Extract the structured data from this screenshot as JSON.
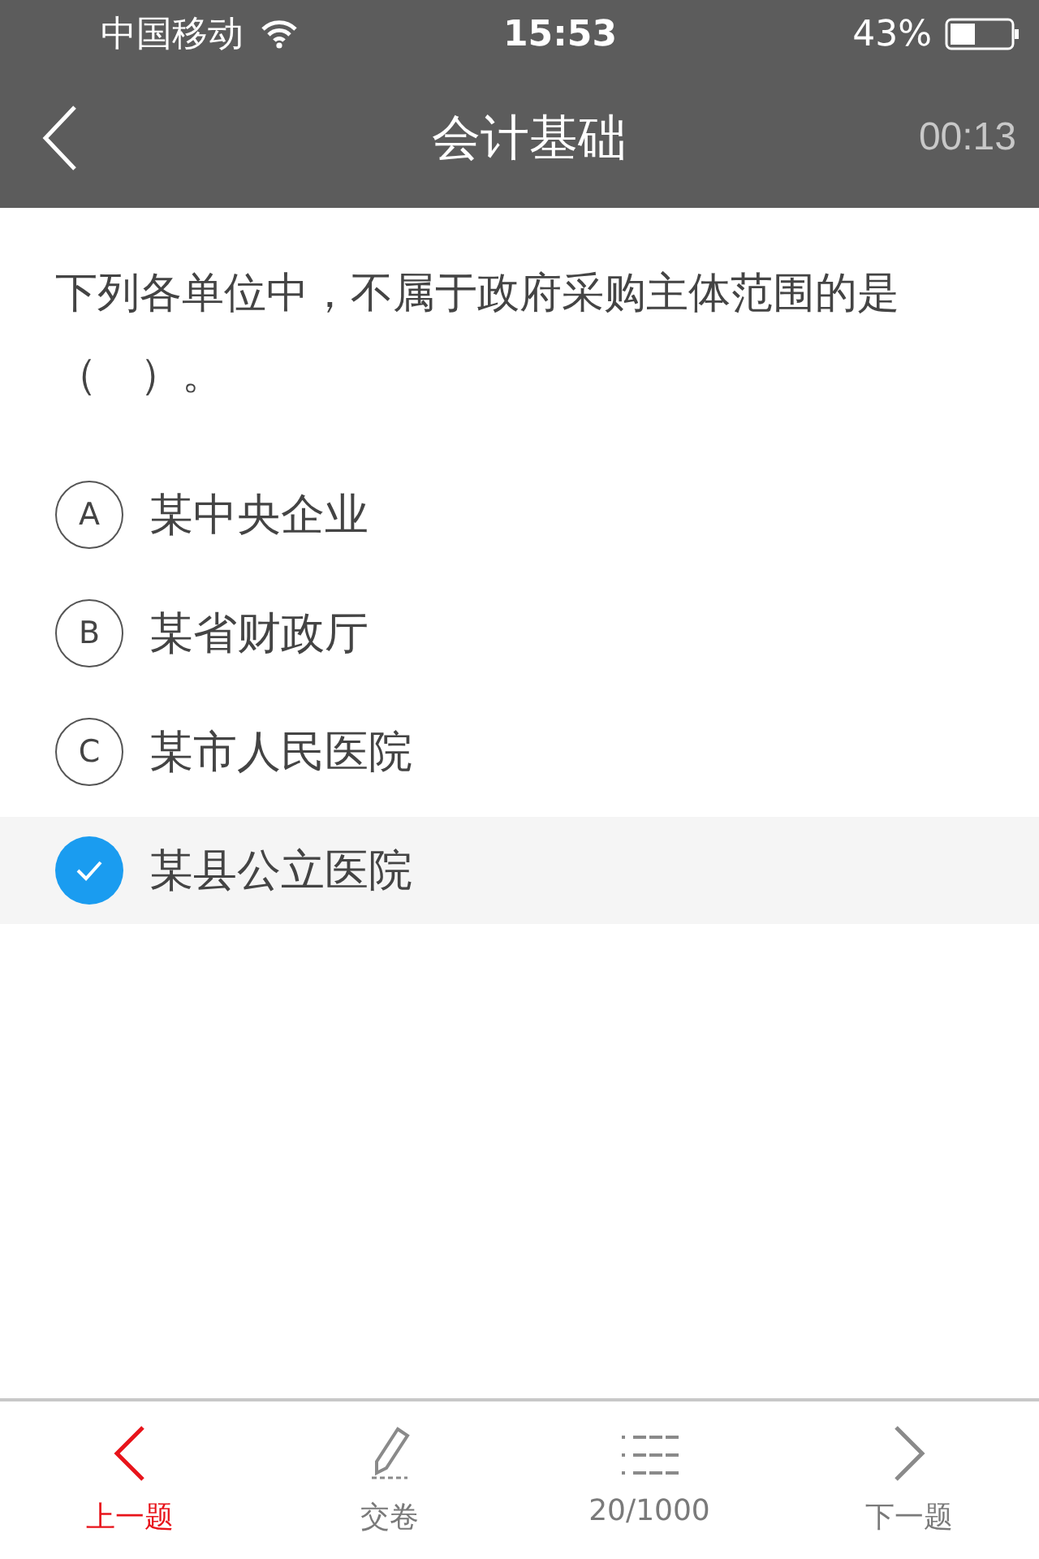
{
  "status_bar": {
    "carrier": "中国移动",
    "time": "15:53",
    "battery": "43%"
  },
  "nav": {
    "title": "会计基础",
    "timer": "00:13"
  },
  "question": "下列各单位中，不属于政府采购主体范围的是（　）。",
  "options": [
    {
      "letter": "A",
      "text": "某中央企业",
      "selected": false
    },
    {
      "letter": "B",
      "text": "某省财政厅",
      "selected": false
    },
    {
      "letter": "C",
      "text": "某市人民医院",
      "selected": false
    },
    {
      "text": "某县公立医院",
      "selected": true
    }
  ],
  "toolbar": [
    {
      "kind": "prev",
      "label": "上一题",
      "highlighted": true
    },
    {
      "kind": "submit",
      "label": "交卷",
      "highlighted": false
    },
    {
      "kind": "list",
      "label": "20/1000",
      "highlighted": false
    },
    {
      "kind": "next",
      "label": "下一题",
      "highlighted": false
    }
  ]
}
